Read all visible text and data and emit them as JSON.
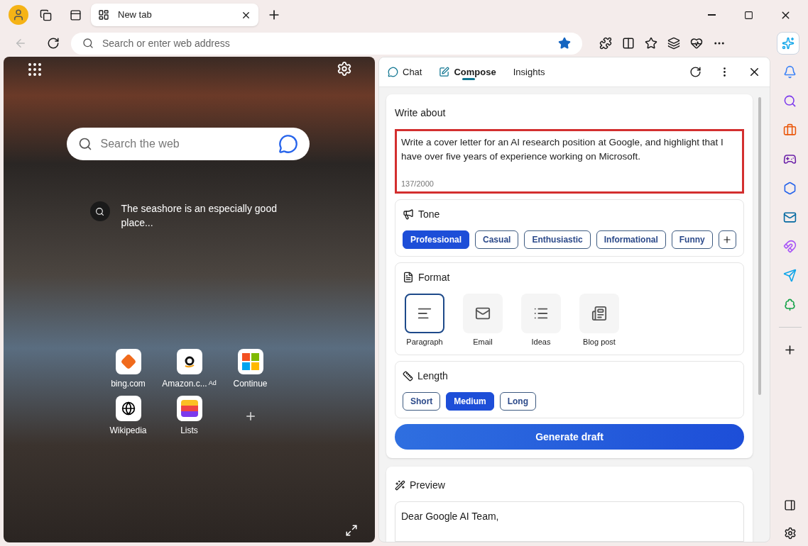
{
  "browser_tabs": [
    {
      "label": "New tab",
      "selected": true
    }
  ],
  "address_bar": {
    "placeholder": "Search or enter web address"
  },
  "new_tab_page": {
    "search": {
      "placeholder": "Search the web"
    },
    "caption": "The seashore is an especially good place...",
    "quick_links": [
      {
        "label": "bing.com",
        "kind": "bing"
      },
      {
        "label": "Amazon.c...",
        "badge": "Ad",
        "kind": "amazon"
      },
      {
        "label": "Continue",
        "kind": "windows"
      },
      {
        "label": "Wikipedia",
        "kind": "wiki"
      },
      {
        "label": "Lists",
        "kind": "lists"
      }
    ]
  },
  "copilot": {
    "tabs": [
      {
        "label": "Chat",
        "kind": "chat",
        "selected": false
      },
      {
        "label": "Compose",
        "kind": "compose",
        "selected": true
      },
      {
        "label": "Insights",
        "kind": "insights",
        "selected": false
      }
    ],
    "write_about": {
      "label": "Write about",
      "value": "Write a cover letter for an AI research position at Google, and highlight that I have over five years of experience working on Microsoft.",
      "counter": "137/2000"
    },
    "tone": {
      "label": "Tone",
      "options": [
        {
          "label": "Professional",
          "selected": true
        },
        {
          "label": "Casual",
          "selected": false
        },
        {
          "label": "Enthusiastic",
          "selected": false
        },
        {
          "label": "Informational",
          "selected": false
        },
        {
          "label": "Funny",
          "selected": false
        }
      ]
    },
    "format": {
      "label": "Format",
      "options": [
        {
          "label": "Paragraph",
          "kind": "paragraph",
          "selected": true
        },
        {
          "label": "Email",
          "kind": "email",
          "selected": false
        },
        {
          "label": "Ideas",
          "kind": "ideas",
          "selected": false
        },
        {
          "label": "Blog post",
          "kind": "blog",
          "selected": false
        }
      ]
    },
    "length": {
      "label": "Length",
      "options": [
        {
          "label": "Short",
          "selected": false
        },
        {
          "label": "Medium",
          "selected": true
        },
        {
          "label": "Long",
          "selected": false
        }
      ]
    },
    "generate_button": "Generate draft",
    "preview": {
      "label": "Preview",
      "text": "Dear Google AI Team,"
    }
  }
}
